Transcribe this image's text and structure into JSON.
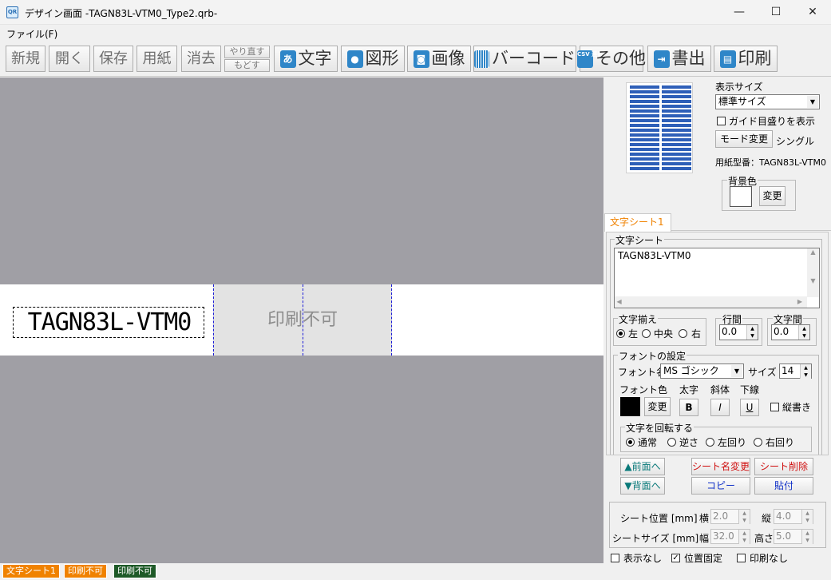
{
  "window": {
    "title": "デザイン画面 -TAGN83L-VTM0_Type2.qrb-",
    "app_icon": "QR",
    "minimize": "—",
    "maximize": "☐",
    "close": "✕"
  },
  "menu": {
    "file": "ファイル(F)"
  },
  "toolbar": {
    "new": "新規",
    "open": "開く",
    "save": "保存",
    "paper": "用紙",
    "erase": "消去",
    "redo": "やり直す",
    "undo": "もどす",
    "text": "文字",
    "text_icon": "あ",
    "shape": "図形",
    "image": "画像",
    "barcode": "バーコード",
    "other": "その他",
    "other_icon": "CSV 連番",
    "export": "書出",
    "print": "印刷"
  },
  "canvas": {
    "text_sheet_value": "TAGN83L-VTM0",
    "nonprint_label": "印刷不可",
    "background_color": "#a09fa5"
  },
  "statusbar": {
    "tabs": [
      {
        "label": "文字シート1",
        "color": "#f08200"
      },
      {
        "label": "印刷不可",
        "color": "#f08200"
      },
      {
        "label": "印刷不可",
        "color": "#1e5a28"
      }
    ]
  },
  "panel": {
    "display_size_label": "表示サイズ",
    "display_size_value": "標準サイズ",
    "guide_label": "ガイド目盛りを表示",
    "guide_checked": false,
    "mode_button": "モード変更",
    "mode_value": "シングル",
    "paper_model": "用紙型番：TAGN83L-VTM0",
    "bg_label": "背景色",
    "bg_change": "変更",
    "sheet_tab": "文字シート1",
    "text_sheet_group": "文字シート",
    "text_value": "TAGN83L-VTM0",
    "align_group": "文字揃え",
    "align_left": "左",
    "align_center": "中央",
    "align_right": "右",
    "align_selected": "左",
    "line_spacing_label": "行間",
    "line_spacing_value": "0.0",
    "char_spacing_label": "文字間",
    "char_spacing_value": "0.0",
    "font_group": "フォントの設定",
    "font_name_label": "フォント名",
    "font_name_value": "MS ゴシック",
    "size_label": "サイズ",
    "size_value": "14",
    "font_color_label": "フォント色",
    "font_color": "#000000",
    "font_color_change": "変更",
    "bold_label": "太字",
    "italic_label": "斜体",
    "underline_label": "下線",
    "bold_btn": "B",
    "italic_btn": "I",
    "underline_btn": "U",
    "vertical_label": "縦書き",
    "vertical_checked": false,
    "rotate_group": "文字を回転する",
    "rotate_normal": "通常",
    "rotate_reverse": "逆さ",
    "rotate_left": "左回り",
    "rotate_right": "右回り",
    "rotate_selected": "通常",
    "front_btn": "▲前面へ",
    "back_btn": "▼背面へ",
    "rename_btn": "シート名変更",
    "delete_btn": "シート削除",
    "copy_btn": "コピー",
    "paste_btn": "貼付",
    "position_label": "シート位置 [mm]",
    "pos_x_label": "横",
    "pos_x": "2.0",
    "pos_y_label": "縦",
    "pos_y": "4.0",
    "size_sheet_label": "シートサイズ [mm]",
    "width_label": "幅",
    "width": "32.0",
    "height_label": "高さ",
    "height": "5.0",
    "hide_label": "表示なし",
    "hide_checked": false,
    "lock_label": "位置固定",
    "lock_checked": true,
    "noprint_label": "印刷なし",
    "noprint_checked": false
  }
}
